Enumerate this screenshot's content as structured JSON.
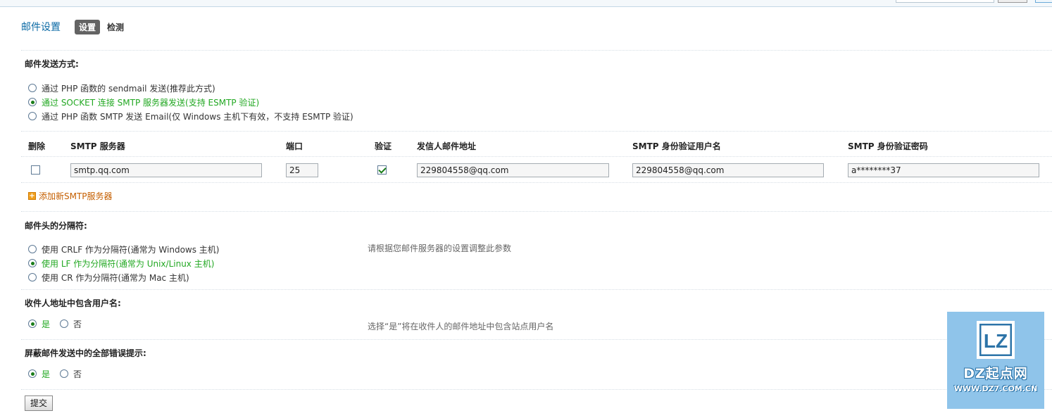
{
  "header": {
    "title": "邮件设置",
    "tabs": [
      {
        "label": "设置",
        "active": true
      },
      {
        "label": "检测",
        "active": false
      }
    ]
  },
  "send_method": {
    "label": "邮件发送方式:",
    "options": [
      {
        "label": "通过 PHP 函数的 sendmail 发送(推荐此方式)",
        "selected": false
      },
      {
        "label": "通过 SOCKET 连接 SMTP 服务器发送(支持 ESMTP 验证)",
        "selected": true
      },
      {
        "label": "通过 PHP 函数 SMTP 发送 Email(仅 Windows 主机下有效，不支持 ESMTP 验证)",
        "selected": false
      }
    ]
  },
  "smtp_table": {
    "headers": {
      "delete": "删除",
      "server": "SMTP 服务器",
      "port": "端口",
      "auth": "验证",
      "from": "发信人邮件地址",
      "username": "SMTP 身份验证用户名",
      "password": "SMTP 身份验证密码"
    },
    "rows": [
      {
        "delete_checked": false,
        "server": "smtp.qq.com",
        "port": "25",
        "auth_checked": true,
        "from": "229804558@qq.com",
        "username": "229804558@qq.com",
        "password": "a********37"
      }
    ],
    "add_label": "添加新SMTP服务器"
  },
  "separator": {
    "label": "邮件头的分隔符:",
    "hint": "请根据您邮件服务器的设置调整此参数",
    "options": [
      {
        "label": "使用 CRLF 作为分隔符(通常为 Windows 主机)",
        "selected": false
      },
      {
        "label": "使用 LF 作为分隔符(通常为 Unix/Linux 主机)",
        "selected": true
      },
      {
        "label": "使用 CR 作为分隔符(通常为 Mac 主机)",
        "selected": false
      }
    ]
  },
  "include_username": {
    "label": "收件人地址中包含用户名:",
    "hint": "选择“是”将在收件人的邮件地址中包含站点用户名",
    "yes": "是",
    "no": "否",
    "value": "yes"
  },
  "silent_errors": {
    "label": "屏蔽邮件发送中的全部错误提示:",
    "yes": "是",
    "no": "否",
    "value": "yes"
  },
  "submit_label": "提交",
  "watermark": {
    "logo": "LZ",
    "name": "DZ起点网",
    "url": "WWW.DZ7.COM.CN"
  },
  "colors": {
    "title": "#0b6aa5",
    "selected_option": "#22a822",
    "add_link": "#c55f00",
    "watermark_bg": "#8fc4ea"
  }
}
